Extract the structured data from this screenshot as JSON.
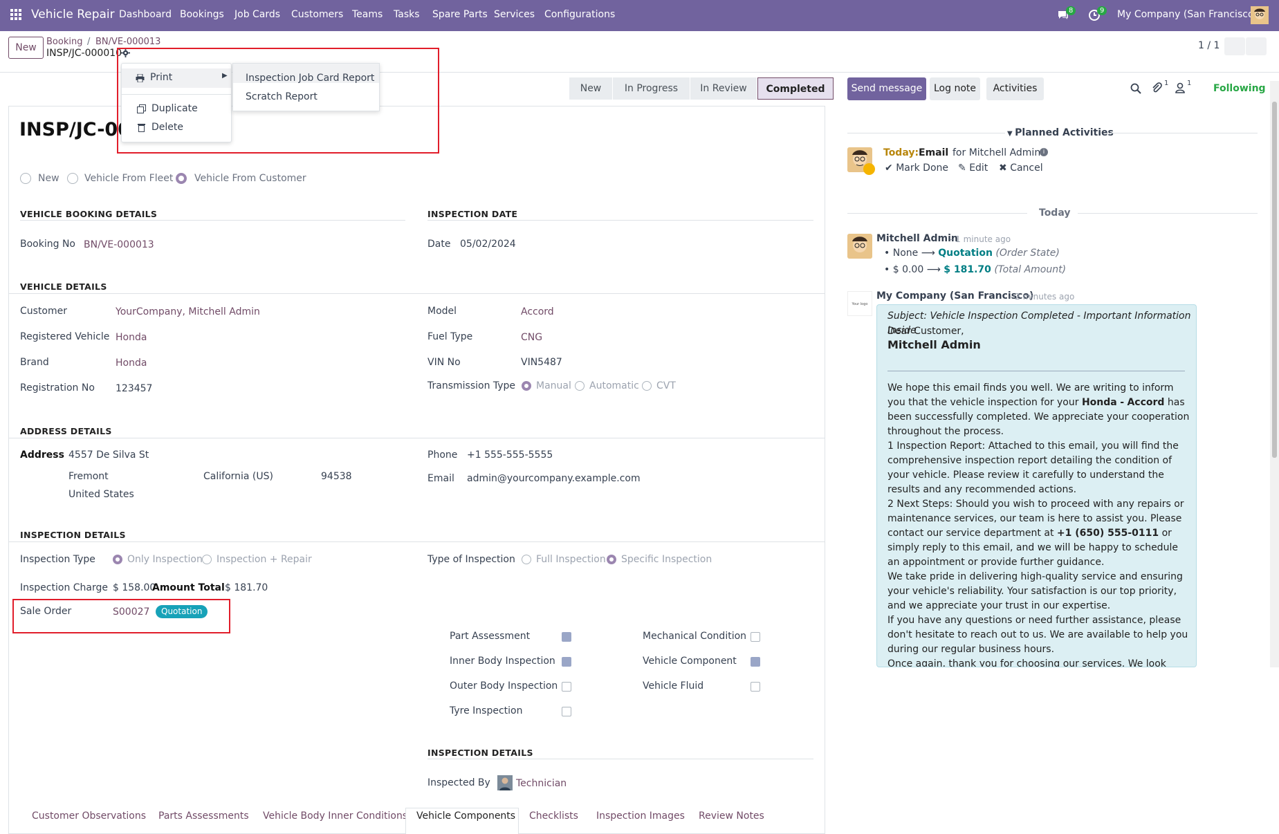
{
  "navbar": {
    "app_name": "Vehicle Repair",
    "menu": [
      "Dashboard",
      "Bookings",
      "Job Cards",
      "Customers",
      "Teams",
      "Tasks",
      "Spare Parts",
      "Services",
      "Configurations"
    ],
    "messages_count": "8",
    "activities_count": "9",
    "company": "My Company (San Francisco)"
  },
  "control_panel": {
    "new_label": "New",
    "breadcrumb": [
      "Booking",
      "BN/VE-000013"
    ],
    "record_name": "INSP/JC-000010",
    "pager": "1 / 1"
  },
  "action_menu": {
    "print_label": "Print",
    "duplicate_label": "Duplicate",
    "delete_label": "Delete",
    "print_items": [
      "Inspection Job Card Report",
      "Scratch Report"
    ]
  },
  "stages": [
    "New",
    "In Progress",
    "In Review",
    "Completed"
  ],
  "active_stage": "Completed",
  "form": {
    "title": "INSP/JC-000",
    "source_options": [
      "New",
      "Vehicle From Fleet",
      "Vehicle From Customer"
    ],
    "booking_section": "VEHICLE BOOKING DETAILS",
    "booking_no_label": "Booking No",
    "booking_no": "BN/VE-000013",
    "inspection_date_section": "INSPECTION DATE",
    "date_label": "Date",
    "date": "05/02/2024",
    "vehicle_section": "VEHICLE DETAILS",
    "customer_label": "Customer",
    "customer": "YourCompany, Mitchell Admin",
    "reg_vehicle_label": "Registered Vehicle",
    "reg_vehicle": "Honda",
    "brand_label": "Brand",
    "brand": "Honda",
    "reg_no_label": "Registration No",
    "reg_no": "123457",
    "model_label": "Model",
    "model": "Accord",
    "fuel_label": "Fuel Type",
    "fuel": "CNG",
    "vin_label": "VIN No",
    "vin": "VIN5487",
    "transmission_label": "Transmission Type",
    "transmission_options": [
      "Manual",
      "Automatic",
      "CVT"
    ],
    "address_section": "ADDRESS DETAILS",
    "address_label": "Address",
    "street": "4557 De Silva St",
    "city": "Fremont",
    "state": "California (US)",
    "zip": "94538",
    "country": "United States",
    "phone_label": "Phone",
    "phone": "+1 555-555-5555",
    "email_label": "Email",
    "email": "admin@yourcompany.example.com",
    "inspection_section": "INSPECTION DETAILS",
    "inspection_type_label": "Inspection Type",
    "inspection_type_options": [
      "Only Inspection",
      "Inspection + Repair"
    ],
    "type_of_inspection_label": "Type of Inspection",
    "type_of_inspection_options": [
      "Full Inspection",
      "Specific Inspection"
    ],
    "charge_label": "Inspection Charge",
    "charge": "$ 158.00",
    "amount_total_label": "Amount Total",
    "amount_total": "$ 181.70",
    "sale_order_label": "Sale Order",
    "sale_order": "S00027",
    "sale_order_badge": "Quotation",
    "checks": [
      {
        "label": "Part Assessment",
        "checked": true
      },
      {
        "label": "Mechanical Condition",
        "checked": false
      },
      {
        "label": "Inner Body Inspection",
        "checked": true
      },
      {
        "label": "Vehicle Component",
        "checked": true
      },
      {
        "label": "Outer Body Inspection",
        "checked": false
      },
      {
        "label": "Vehicle Fluid",
        "checked": false
      },
      {
        "label": "Tyre Inspection",
        "checked": false
      }
    ],
    "inspection_section_2": "INSPECTION DETAILS",
    "inspected_by_label": "Inspected By",
    "inspected_by": "Technician",
    "tabs": [
      "Customer Observations",
      "Parts Assessments",
      "Vehicle Body Inner Conditions",
      "Vehicle Components",
      "Checklists",
      "Inspection Images",
      "Review Notes"
    ],
    "active_tab": "Vehicle Components"
  },
  "chatter": {
    "send_message": "Send message",
    "log_note": "Log note",
    "activities": "Activities",
    "attachments_count": "1",
    "followers_count": "1",
    "following": "Following",
    "planned_activities": "Planned Activities",
    "activity_today": "Today:",
    "activity_type": "Email",
    "activity_for": "for Mitchell Admin",
    "mark_done": "Mark Done",
    "edit": "Edit",
    "cancel": "Cancel",
    "date_separator": "Today",
    "msg1_author": "Mitchell Admin",
    "msg1_time": "- 1 minute ago",
    "msg1_changes": [
      {
        "from": "None",
        "to": "Quotation",
        "field": "(Order State)"
      },
      {
        "from": "$ 0.00",
        "to": "$ 181.70",
        "field": "(Total Amount)"
      }
    ],
    "msg2_author": "My Company (San Francisco)",
    "msg2_time": "- 2 minutes ago",
    "msg2_logo": "Your logo",
    "msg2_subject": "Subject: Vehicle Inspection Completed - Important Information Inside",
    "msg2_greeting": "Dear Customer,",
    "msg2_name": "Mitchell Admin",
    "msg2_p1_a": "We hope this email finds you well. We are writing to inform you that the vehicle inspection for your",
    "msg2_p1_b": "Honda",
    "msg2_p1_c": "-",
    "msg2_p1_d": "Accord",
    "msg2_p1_e": "has been successfully completed. We appreciate your cooperation throughout the process.",
    "msg2_p2": "1 Inspection Report: Attached to this email, you will find the comprehensive inspection report detailing the condition of your vehicle. Please review it carefully to understand the results and any recommended actions.",
    "msg2_p3_a": "2 Next Steps: Should you wish to proceed with any repairs or maintenance services, our team is here to assist you. Please contact our service department at",
    "msg2_p3_b": "+1 (650) 555-0111",
    "msg2_p3_c": "or simply reply to this email, and we will be happy to schedule an appointment or provide further guidance.",
    "msg2_p4": "We take pride in delivering high-quality service and ensuring your vehicle's reliability. Your satisfaction is our top priority, and we appreciate your trust in our expertise.",
    "msg2_p5": "If you have any questions or need further assistance, please don't hesitate to reach out to us. We are available to help you during our regular business hours.",
    "msg2_p6": "Once again, thank you for choosing our services. We look forward"
  },
  "colors": {
    "navbar": "#71639e",
    "brand": "#714B67",
    "following": "#28a745",
    "quotation_badge": "#17a2b8",
    "highlight": "#e11d2a"
  }
}
